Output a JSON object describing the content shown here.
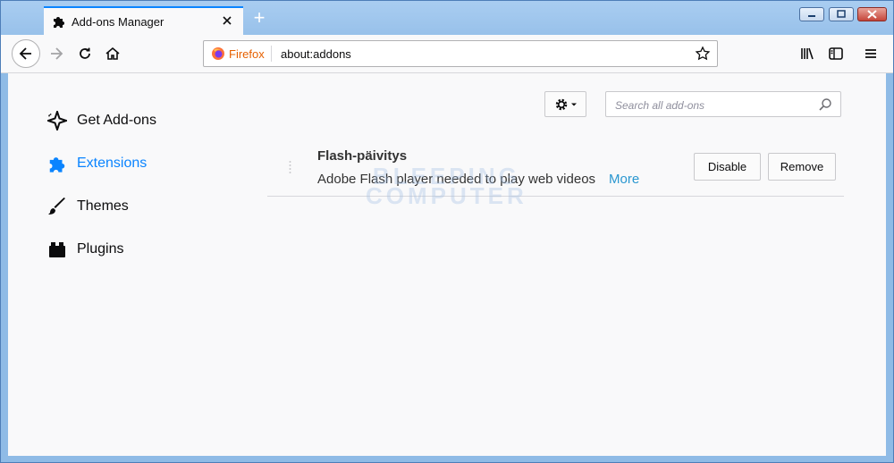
{
  "tab": {
    "title": "Add-ons Manager"
  },
  "urlbar": {
    "identity": "Firefox",
    "url": "about:addons"
  },
  "sidebar": {
    "items": [
      {
        "label": "Get Add-ons",
        "icon": "sparkle-icon",
        "selected": false
      },
      {
        "label": "Extensions",
        "icon": "puzzle-icon",
        "selected": true
      },
      {
        "label": "Themes",
        "icon": "brush-icon",
        "selected": false
      },
      {
        "label": "Plugins",
        "icon": "plugin-icon",
        "selected": false
      }
    ]
  },
  "search": {
    "placeholder": "Search all add-ons"
  },
  "addon": {
    "name": "Flash-päivitys",
    "description": "Adobe Flash player needed to play web videos",
    "more_label": "More",
    "disable_label": "Disable",
    "remove_label": "Remove"
  },
  "watermark": {
    "line1": "BLEEPING",
    "line2": "COMPUTER"
  },
  "colors": {
    "accent": "#0a84ff",
    "link": "#2a97d0",
    "titlebar": "#a9cdf1"
  }
}
